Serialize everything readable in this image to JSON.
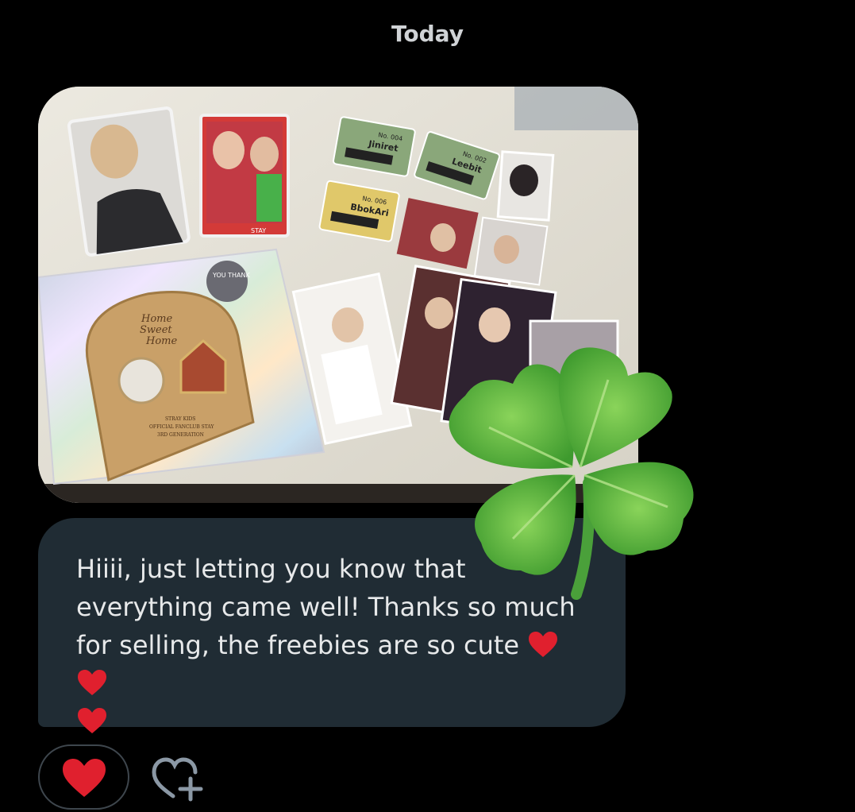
{
  "header": {
    "date_label": "Today"
  },
  "message": {
    "text": "Hiiii, just letting you know that\neverything came well! Thanks so much\nfor selling, the freebies are so cute",
    "bubble_color": "#202c34"
  },
  "photo": {
    "card_labels": {
      "card_1": "No. 004",
      "card_1_name": "Jiniret",
      "card_2": "No. 002",
      "card_2_name": "Leebit",
      "card_3": "No. 006",
      "card_3_name": "BbokAri",
      "pin_line1": "Home",
      "pin_line2": "Sweet",
      "pin_line3": "Home",
      "pin_sub1": "STRAY KIDS",
      "pin_sub2": "OFFICIAL FANCLUB STAY",
      "pin_sub3": "3RD GENERATION",
      "sticker": "YOU THANK",
      "pc_tag": "STAY"
    }
  },
  "reactions": {
    "current": "red-heart",
    "add_icon": "add-reaction-heart-icon"
  },
  "colors": {
    "background": "#000000",
    "heart": "#e0202e",
    "clover": "#4caf3a"
  }
}
